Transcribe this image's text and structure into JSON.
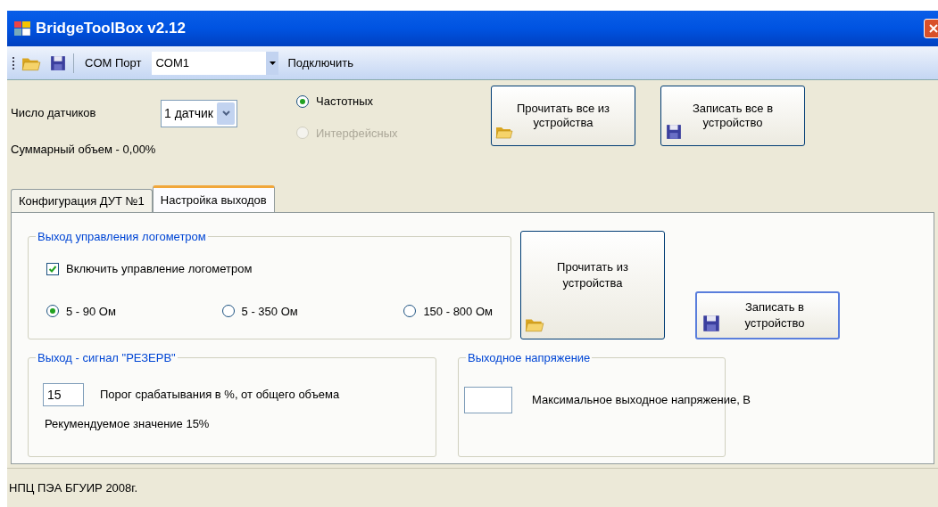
{
  "window": {
    "title": "BridgeToolBox v2.12"
  },
  "toolbar": {
    "port_label": "COM Порт",
    "port_value": "COM1",
    "connect": "Подключить"
  },
  "sensors": {
    "label": "Число датчиков",
    "value": "1 датчик",
    "summary": "Суммарный объем - 0,00%"
  },
  "sensor_types": [
    {
      "label": "Частотных",
      "selected": true,
      "disabled": false
    },
    {
      "label": "Интерфейсных",
      "selected": false,
      "disabled": true
    }
  ],
  "top_buttons": [
    {
      "label": "Прочитать все из устройства"
    },
    {
      "label": "Записать все в устройство"
    }
  ],
  "tabs": [
    {
      "label": "Конфигурация ДУТ №1",
      "selected": false
    },
    {
      "label": "Настройка выходов",
      "selected": true
    }
  ],
  "logometer": {
    "title": "Выход управления логометром",
    "checkbox": {
      "label": "Включить управление логометром",
      "checked": true
    },
    "ranges": [
      {
        "label": "5 - 90 Ом",
        "selected": true
      },
      {
        "label": "5 - 350 Ом",
        "selected": false
      },
      {
        "label": "150 - 800 Ом",
        "selected": false
      }
    ]
  },
  "read_button": {
    "label": "Прочитать из устройства"
  },
  "write_button": {
    "label": "Записать в устройство"
  },
  "reserve": {
    "title": "Выход - сигнал \"РЕЗЕРВ\"",
    "value": "15",
    "label": "Порог срабатывания в %, от общего объема",
    "hint": "Рекумендуемое значение 15%"
  },
  "voltage": {
    "title": "Выходное напряжение",
    "label": "Максимальное выходное напряжение, В"
  },
  "status_bar": "НПЦ ПЭА БГУИР 2008г."
}
